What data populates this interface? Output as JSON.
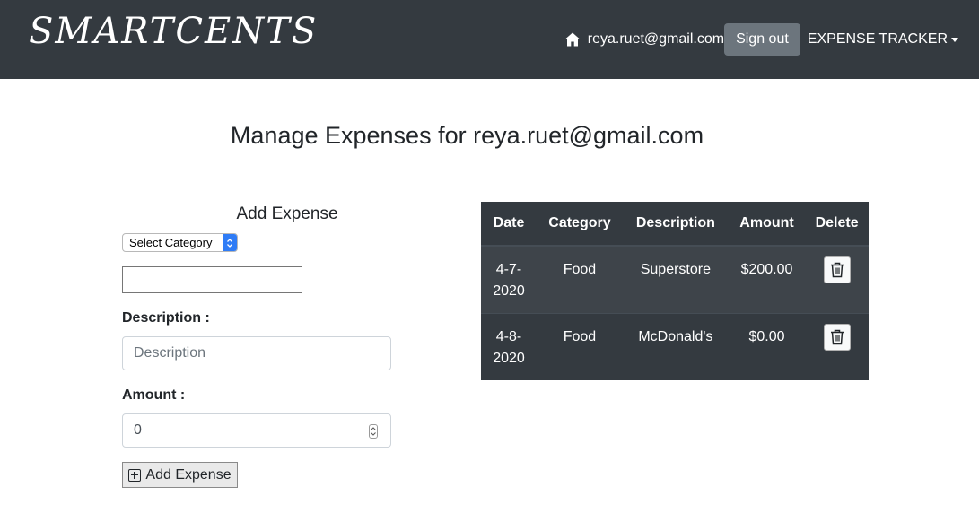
{
  "navbar": {
    "brand": "SMARTCENTS",
    "user_email": "reya.ruet@gmail.com",
    "signout_label": "Sign out",
    "tracker_label": "EXPENSE TRACKER",
    "home_icon": "home-icon",
    "background": "#343a40"
  },
  "page": {
    "title": "Manage Expenses for reya.ruet@gmail.com"
  },
  "form": {
    "title": "Add Expense",
    "category_select": {
      "selected": "Select Category"
    },
    "extra_input_value": "",
    "description_label": "Description :",
    "description_placeholder": "Description",
    "amount_label": "Amount :",
    "amount_value": "0",
    "add_button_label": "Add Expense",
    "add_button_icon": "plus-square-icon"
  },
  "table": {
    "headers": [
      "Date",
      "Category",
      "Description",
      "Amount",
      "Delete"
    ],
    "rows": [
      {
        "date_line1": "4-7-",
        "date_line2": "2020",
        "category": "Food",
        "description": "Superstore",
        "amount": "$200.00"
      },
      {
        "date_line1": "4-8-",
        "date_line2": "2020",
        "category": "Food",
        "description": "McDonald's",
        "amount": "$0.00"
      }
    ],
    "delete_icon": "trash-icon",
    "background": "#343a40"
  }
}
